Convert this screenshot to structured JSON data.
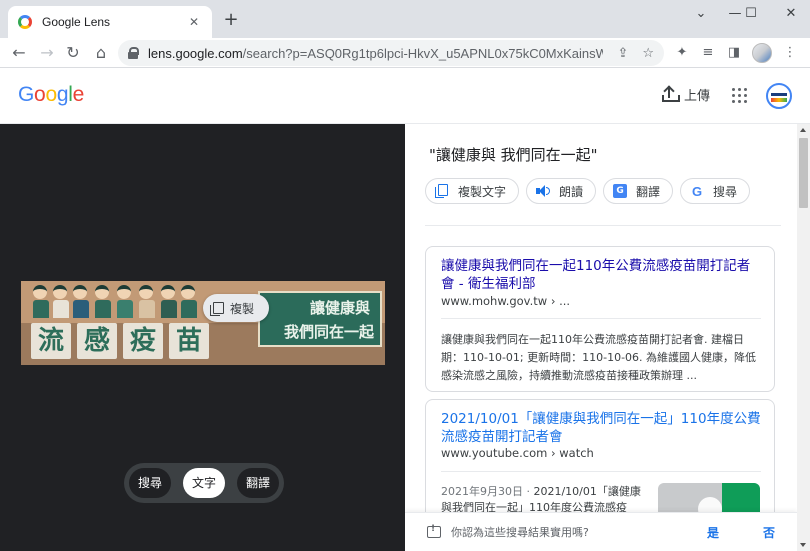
{
  "browser": {
    "tab_title": "Google Lens",
    "url_host": "lens.google.com",
    "url_path": "/search?p=ASQ0Rg1tp6lpci-HkvX_u5APNL0x75kC0MxKainsW..."
  },
  "header": {
    "logo_letters": [
      {
        "char": "G",
        "color": "#4285f4"
      },
      {
        "char": "o",
        "color": "#ea4335"
      },
      {
        "char": "o",
        "color": "#fbbc05"
      },
      {
        "char": "g",
        "color": "#4285f4"
      },
      {
        "char": "l",
        "color": "#34a853"
      },
      {
        "char": "e",
        "color": "#ea4335"
      }
    ],
    "upload_label": "上傳"
  },
  "image_pane": {
    "banner_title_chars": [
      "流",
      "感",
      "疫",
      "苗"
    ],
    "banner_slogan_line1": "讓健康與",
    "banner_slogan_line2": "我們同在一起",
    "copy_chip_label": "複製",
    "modes": [
      {
        "label": "搜尋",
        "active": false
      },
      {
        "label": "文字",
        "active": true
      },
      {
        "label": "翻譯",
        "active": false
      }
    ]
  },
  "results": {
    "query": "\"讓健康與 我們同在一起\"",
    "actions": [
      {
        "label": "複製文字",
        "icon": "copy-icon"
      },
      {
        "label": "朗讀",
        "icon": "speaker-icon"
      },
      {
        "label": "翻譯",
        "icon": "translate-icon"
      },
      {
        "label": "搜尋",
        "icon": "google-icon"
      }
    ],
    "cards": [
      {
        "title": "讓健康與我們同在一起110年公費流感疫苗開打記者會 - 衛生福利部",
        "url": "www.mohw.gov.tw › ...",
        "snippet": "讓健康與我們同在一起110年公費流感疫苗開打記者會. 建檔日期：110-10-01; 更新時間：110-10-06. 為維護國人健康，降低感染流感之風險，持續推動流感疫苗接種政策辦理 ..."
      },
      {
        "title": "2021/10/01「讓健康與我們同在一起」110年度公費流感疫苗開打記者會",
        "url": "www.youtube.com › watch",
        "snippet_date": "2021年9月30日 · ",
        "snippet": "2021/10/01「讓健康與我們同在一起」110年度公費流感疫"
      }
    ],
    "feedback": {
      "question": "你認為這些搜尋結果實用嗎?",
      "yes": "是",
      "no": "否"
    }
  }
}
